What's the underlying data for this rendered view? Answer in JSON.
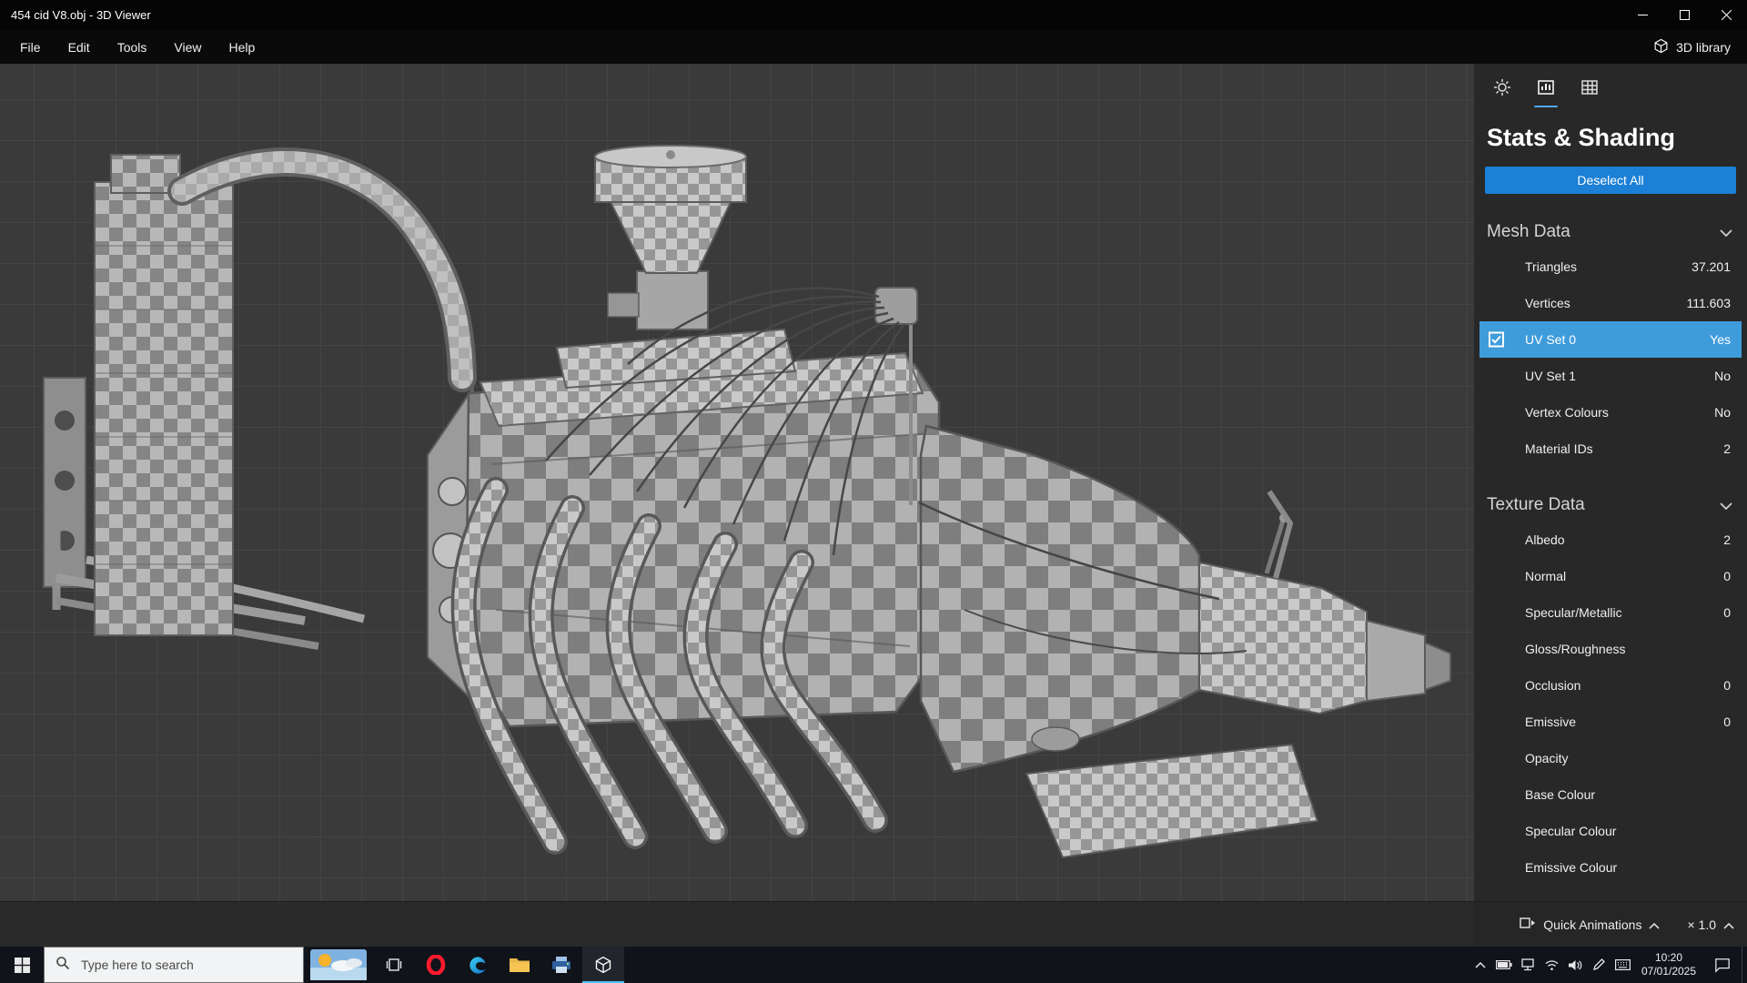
{
  "titlebar": {
    "title": "454 cid V8.obj - 3D Viewer"
  },
  "menubar": {
    "items": [
      "File",
      "Edit",
      "Tools",
      "View",
      "Help"
    ],
    "library": "3D library"
  },
  "panel": {
    "title": "Stats & Shading",
    "deselect": "Deselect All",
    "mesh": {
      "title": "Mesh Data",
      "rows": [
        {
          "label": "Triangles",
          "value": "37.201"
        },
        {
          "label": "Vertices",
          "value": "111.603"
        },
        {
          "label": "UV Set 0",
          "value": "Yes"
        },
        {
          "label": "UV Set 1",
          "value": "No"
        },
        {
          "label": "Vertex Colours",
          "value": "No"
        },
        {
          "label": "Material IDs",
          "value": "2"
        }
      ]
    },
    "texture": {
      "title": "Texture Data",
      "rows": [
        {
          "label": "Albedo",
          "value": "2"
        },
        {
          "label": "Normal",
          "value": "0"
        },
        {
          "label": "Specular/Metallic",
          "value": "0"
        },
        {
          "label": "Gloss/Roughness",
          "value": ""
        },
        {
          "label": "Occlusion",
          "value": "0"
        },
        {
          "label": "Emissive",
          "value": "0"
        },
        {
          "label": "Opacity",
          "value": ""
        },
        {
          "label": "Base Colour",
          "value": ""
        },
        {
          "label": "Specular Colour",
          "value": ""
        },
        {
          "label": "Emissive Colour",
          "value": ""
        }
      ]
    }
  },
  "animationbar": {
    "quick_animations": "Quick Animations",
    "speed": "× 1.0"
  },
  "taskbar": {
    "search_placeholder": "Type here to search",
    "time": "10:20",
    "date": "07/01/2025"
  },
  "colors": {
    "accent": "#0078d7",
    "row_highlight": "#3f9cdb",
    "button_blue": "#1b80d6",
    "tab_underline": "#4fa8e8"
  }
}
